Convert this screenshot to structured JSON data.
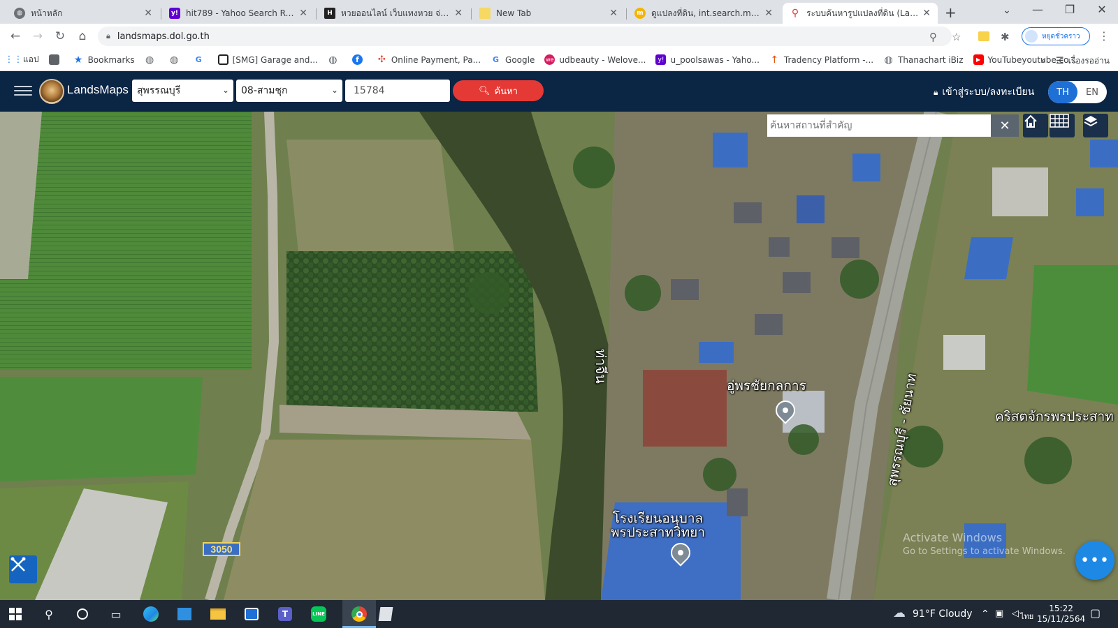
{
  "browser": {
    "tabs": [
      {
        "title": "หน้าหลัก",
        "favicon": "globe-icon"
      },
      {
        "title": "hit789 - Yahoo Search Results",
        "favicon": "yahoo-icon"
      },
      {
        "title": "หวยออนไลน์ เว็บแทงหวย จ่ายบาทล",
        "favicon": "lotto-icon"
      },
      {
        "title": "New Tab",
        "favicon": "note-icon"
      },
      {
        "title": "ดูแปลงที่ดิน, int.search.myway.c",
        "favicon": "myway-icon"
      },
      {
        "title": "ระบบค้นหารูปแปลงที่ดิน (LandsMa",
        "favicon": "map-pin-icon"
      }
    ],
    "url": "landsmaps.dol.go.th",
    "profile_label": "หยุดชั่วคราว",
    "bookmarks": [
      {
        "label": "แอป",
        "icon": "apps-grid-icon"
      },
      {
        "label": "",
        "icon": "bookmark-save-icon"
      },
      {
        "label": "Bookmarks",
        "icon": "star-icon"
      },
      {
        "label": "",
        "icon": "globe-icon"
      },
      {
        "label": "",
        "icon": "globe-icon"
      },
      {
        "label": "",
        "icon": "google-icon"
      },
      {
        "label": "[SMG] Garage and...",
        "icon": "smg-icon"
      },
      {
        "label": "",
        "icon": "globe-icon"
      },
      {
        "label": "",
        "icon": "facebook-icon"
      },
      {
        "label": "Online Payment, Pa...",
        "icon": "payment-icon"
      },
      {
        "label": "Google",
        "icon": "google-icon"
      },
      {
        "label": "udbeauty - Welove...",
        "icon": "we-icon"
      },
      {
        "label": "u_poolsawas - Yaho...",
        "icon": "yahoo-icon"
      },
      {
        "label": "Tradency Platform -...",
        "icon": "tradency-icon"
      },
      {
        "label": "Thanachart iBiz",
        "icon": "globe-icon"
      },
      {
        "label": "YouTubeyoutube.co...",
        "icon": "youtube-icon"
      }
    ],
    "reading_list": "เรื่องรออ่าน"
  },
  "app": {
    "brand": "LandsMaps",
    "province": "สุพรรณบุรี",
    "district": "08-สามชุก",
    "parcel_number": "15784",
    "search_label": "ค้นหา",
    "login_label": "เข้าสู่ระบบ/ลงทะเบียน",
    "lang": {
      "th": "TH",
      "en": "EN"
    },
    "place_search_placeholder": "ค้นหาสถานที่สำคัญ"
  },
  "map": {
    "labels": {
      "river": "ท่าจีน",
      "store": "อู่พรชัยกลการ",
      "road": "สุพรรณบุรี - ชัยนาท",
      "church": "คริสตจักรพรประสาท",
      "school_line1": "โรงเรียนอนุบาล",
      "school_line2": "พรประสาทวิทยา",
      "route": "3050"
    },
    "watermark_line1": "Activate Windows",
    "watermark_line2": "Go to Settings to activate Windows."
  },
  "taskbar": {
    "weather": "91°F  Cloudy",
    "ime": "ไทย",
    "time": "15:22",
    "date": "15/11/2564"
  },
  "colors": {
    "app_header": "#0b2545",
    "search_button": "#e53935",
    "lang_active": "#1e6fd6"
  }
}
